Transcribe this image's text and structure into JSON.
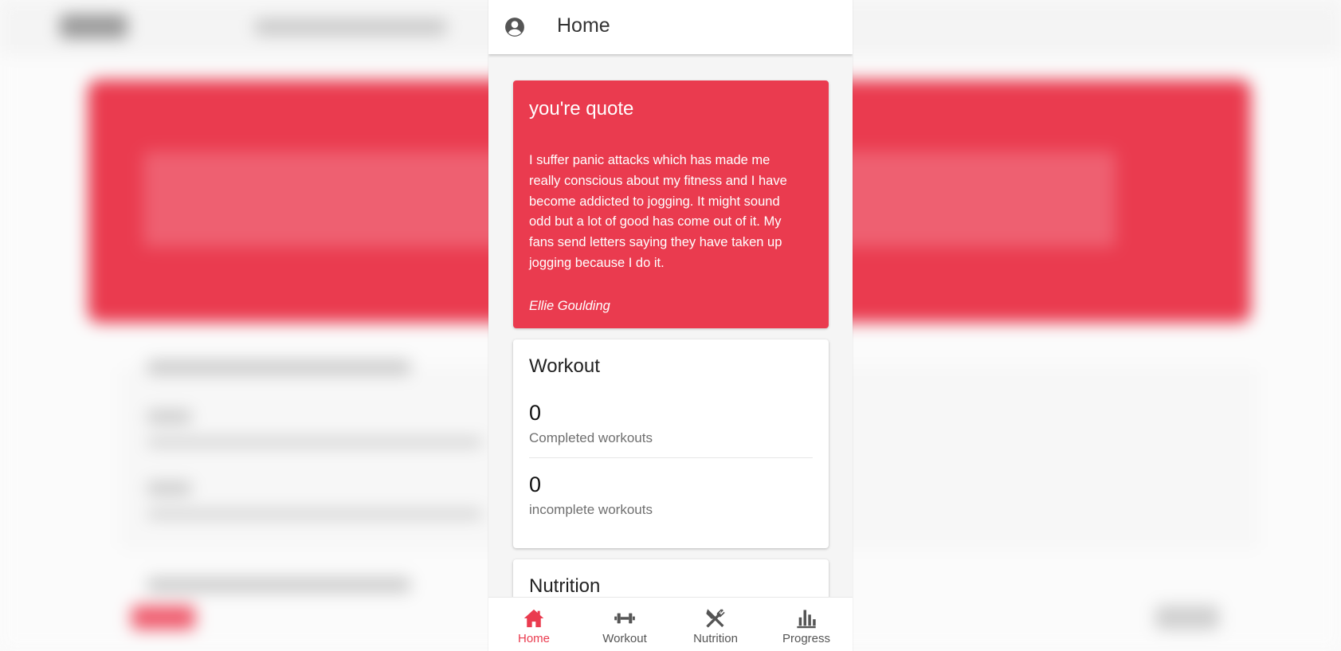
{
  "appbar": {
    "title": "Home"
  },
  "quote_card": {
    "title": "you're quote",
    "body": "I suffer panic attacks which has made me really conscious about my fitness and I have become addicted to jogging. It might sound odd but a lot of good has come out of it. My fans send letters saying they have taken up jogging because I do it.",
    "author": "Ellie Goulding"
  },
  "workout_card": {
    "title": "Workout",
    "completed_value": "0",
    "completed_label": "Completed workouts",
    "incomplete_value": "0",
    "incomplete_label": "incomplete workouts"
  },
  "nutrition_card": {
    "title": "Nutrition"
  },
  "bottom_nav": {
    "active": "Home",
    "items": [
      {
        "label": "Home",
        "icon": "home-icon"
      },
      {
        "label": "Workout",
        "icon": "dumbbell-icon"
      },
      {
        "label": "Nutrition",
        "icon": "utensils-icon"
      },
      {
        "label": "Progress",
        "icon": "bar-chart-icon"
      }
    ]
  },
  "colors": {
    "accent": "#ea3b4f",
    "icon_gray": "#555555"
  }
}
